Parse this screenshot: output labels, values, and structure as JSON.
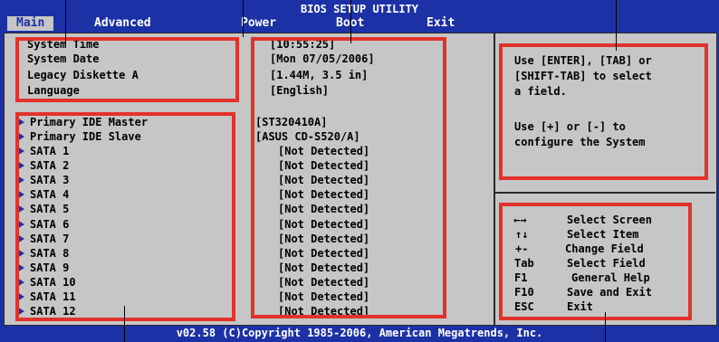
{
  "title": "BIOS SETUP UTILITY",
  "tabs": [
    "Main",
    "Advanced",
    "Power",
    "Boot",
    "Exit"
  ],
  "system": {
    "time_label": "System Time",
    "time_value": "[10:55:25]",
    "date_label": "System Date",
    "date_value": "[Mon 07/05/2006]",
    "diskette_label": "Legacy Diskette A",
    "diskette_value": "[1.44M, 3.5 in]",
    "language_label": "Language",
    "language_value": "[English]"
  },
  "devices": [
    {
      "label": "Primary IDE Master",
      "value": "[ST320410A]"
    },
    {
      "label": "Primary IDE Slave",
      "value": "[ASUS CD-S520/A]"
    },
    {
      "label": "SATA 1",
      "value": "[Not Detected]"
    },
    {
      "label": "SATA 2",
      "value": "[Not Detected]"
    },
    {
      "label": "SATA 3",
      "value": "[Not Detected]"
    },
    {
      "label": "SATA 4",
      "value": "[Not Detected]"
    },
    {
      "label": "SATA 5",
      "value": "[Not Detected]"
    },
    {
      "label": "SATA 6",
      "value": "[Not Detected]"
    },
    {
      "label": "SATA 7",
      "value": "[Not Detected]"
    },
    {
      "label": "SATA 8",
      "value": "[Not Detected]"
    },
    {
      "label": "SATA 9",
      "value": "[Not Detected]"
    },
    {
      "label": "SATA 10",
      "value": "[Not Detected]"
    },
    {
      "label": "SATA 11",
      "value": "[Not Detected]"
    },
    {
      "label": "SATA 12",
      "value": "[Not Detected]"
    }
  ],
  "help": {
    "line1": "Use [ENTER], [TAB] or",
    "line2": "[SHIFT-TAB] to select",
    "line3": "a field.",
    "line4": "Use [+] or [-] to",
    "line5": "configure the System"
  },
  "keys": [
    {
      "key": "←→",
      "action": "Select Screen"
    },
    {
      "key": "↑↓",
      "action": "Select Item"
    },
    {
      "key": "+-",
      "action": "Change Field"
    },
    {
      "key": "Tab",
      "action": "Select Field"
    },
    {
      "key": "F1",
      "action": "General Help"
    },
    {
      "key": "F10",
      "action": "Save and Exit"
    },
    {
      "key": "ESC",
      "action": "Exit"
    }
  ],
  "footer": "v02.58 (C)Copyright 1985-2006, American Megatrends, Inc.",
  "colors": {
    "bios_blue": "#1d31a6",
    "panel_gray": "#c6c6c6",
    "highlight_red": "#e2322b"
  }
}
